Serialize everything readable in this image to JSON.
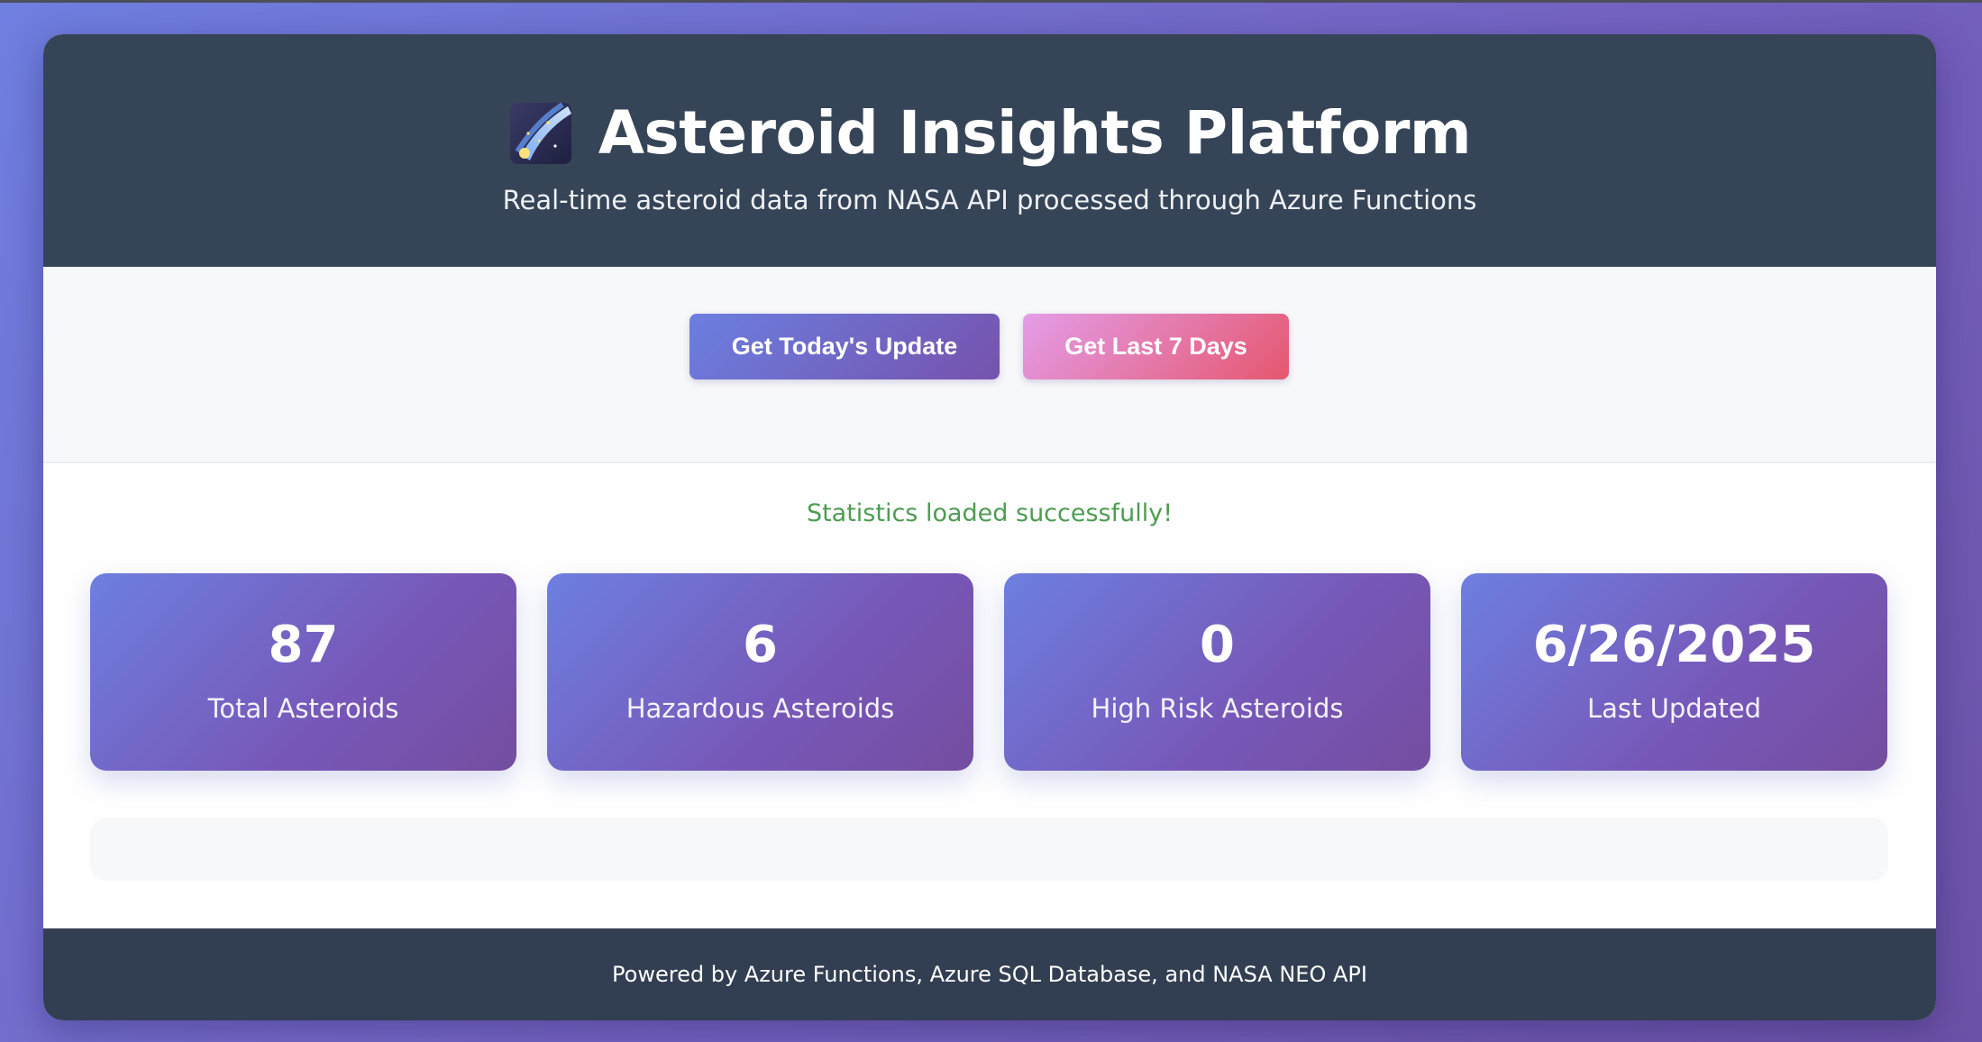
{
  "header": {
    "icon": "comet-icon",
    "title": "Asteroid Insights Platform",
    "subtitle": "Real-time asteroid data from NASA API processed through Azure Functions"
  },
  "controls": {
    "today_label": "Get Today's Update",
    "week_label": "Get Last 7 Days"
  },
  "status": {
    "message": "Statistics loaded successfully!",
    "color": "#4d9c52"
  },
  "stats": [
    {
      "value": "87",
      "label": "Total Asteroids"
    },
    {
      "value": "6",
      "label": "Hazardous Asteroids"
    },
    {
      "value": "0",
      "label": "High Risk Asteroids"
    },
    {
      "value": "6/26/2025",
      "label": "Last Updated"
    }
  ],
  "footer": {
    "text": "Powered by Azure Functions, Azure SQL Database, and NASA NEO API"
  },
  "colors": {
    "header_bg": "#364457",
    "footer_bg": "#323e51",
    "primary_gradient": [
      "#6b7fe0",
      "#7652ad"
    ],
    "secondary_gradient": [
      "#e49de9",
      "#e5576e"
    ]
  }
}
